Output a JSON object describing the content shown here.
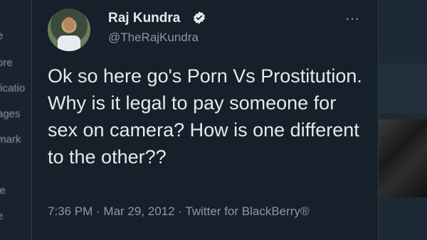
{
  "sidebar": {
    "items": [
      {
        "label": "e"
      },
      {
        "label": "ore"
      },
      {
        "label": "ficatio"
      },
      {
        "label": "ages"
      },
      {
        "label": "mark"
      },
      {
        "label": "le"
      },
      {
        "label": "e"
      }
    ]
  },
  "tweet": {
    "display_name": "Raj Kundra",
    "handle": "@TheRajKundra",
    "text": "Ok so here go's Porn Vs Prostitution. Why is it legal to pay someone for sex on camera? How is one different to the other??",
    "timestamp": "7:36 PM · Mar 29, 2012 · ",
    "source": "Twitter for BlackBerry®",
    "more_icon": "⋯",
    "verified_color": "#e7e9ea"
  }
}
